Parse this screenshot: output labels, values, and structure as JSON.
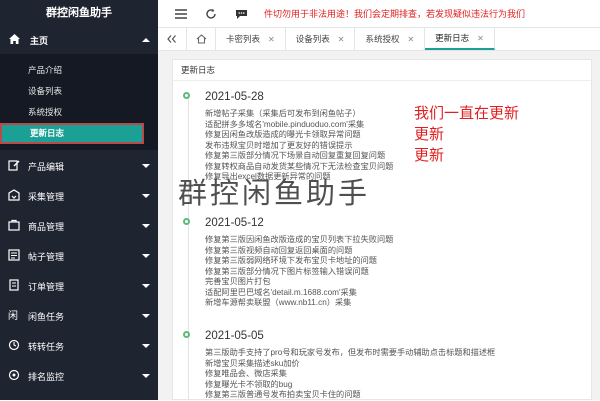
{
  "app": {
    "title": "群控闲鱼助手"
  },
  "sidebar": {
    "home": {
      "label": "主页",
      "icon": "home-icon"
    },
    "home_items": [
      {
        "label": "产品介绍"
      },
      {
        "label": "设备列表"
      },
      {
        "label": "系统授权"
      },
      {
        "label": "更新日志",
        "active": true
      }
    ],
    "menus": [
      {
        "label": "产品编辑",
        "icon": "edit-icon"
      },
      {
        "label": "采集管理",
        "icon": "collect-icon"
      },
      {
        "label": "商品管理",
        "icon": "goods-icon"
      },
      {
        "label": "帖子管理",
        "icon": "post-icon"
      },
      {
        "label": "订单管理",
        "icon": "order-icon"
      },
      {
        "label": "闲鱼任务",
        "icon": "fish-task-icon"
      },
      {
        "label": "转转任务",
        "icon": "zhuanzhuan-task-icon"
      },
      {
        "label": "排名监控",
        "icon": "rank-monitor-icon"
      }
    ]
  },
  "topbar": {
    "notice": "件切勿用于非法用途！我们会定期排查，若发现疑似违法行为我们"
  },
  "tabs": [
    {
      "label": "卡密列表",
      "closable": true
    },
    {
      "label": "设备列表",
      "closable": true
    },
    {
      "label": "系统授权",
      "closable": true
    },
    {
      "label": "更新日志",
      "closable": true,
      "active": true
    }
  ],
  "main": {
    "card_title": "更新日志",
    "entries": [
      {
        "date": "2021-05-28",
        "items": [
          "新增帖子采集（采集后可发布到闲鱼帖子）",
          "适配拼多多域名'mobile.pinduoduo.com'采集",
          "修复因闲鱼改版造成的曝光卡领取异常问题",
          "发布违规宝贝时增加了更友好的错误提示",
          "修复第三版部分情况下场景自动回复重复回复问题",
          "修复转权商品自动发货某些情况下无法检查宝贝问题",
          "修复导出excel数据更新异常的问题"
        ]
      },
      {
        "date": "2021-05-12",
        "items": [
          "修复第三版因闲鱼改版造成的宝贝列表下拉失败问题",
          "修复第三版视频自动回复返回桌面的问题",
          "修复第三版弱网络环境下发布宝贝卡地址的问题",
          "修复第三版部分情况下图片标签输入错误问题",
          "完善宝贝图片打包",
          "适配阿里巴巴域名'detail.m.1688.com'采集",
          "新增车源帮卖联盟（www.nb11.cn）采集"
        ]
      },
      {
        "date": "2021-05-05",
        "items": [
          "第三版助手支持了pro号和玩家号发布，但发布时需要手动辅助点击标题和描述框",
          "新增宝贝采集描述sku加价",
          "修复唯品会、微店采集",
          "修复曝光卡不领取的bug",
          "修复第三版普通号发布拍卖宝贝卡住的问题"
        ]
      }
    ]
  },
  "overlay": {
    "red_lines": [
      "我们一直在更新",
      "更新",
      "更新"
    ],
    "watermark": "群控闲鱼助手"
  },
  "colors": {
    "sidebar_bg": "#1f2431",
    "active_item": "#1aa094",
    "notice_red": "#e02020",
    "timeline_dot": "#5fb878"
  }
}
